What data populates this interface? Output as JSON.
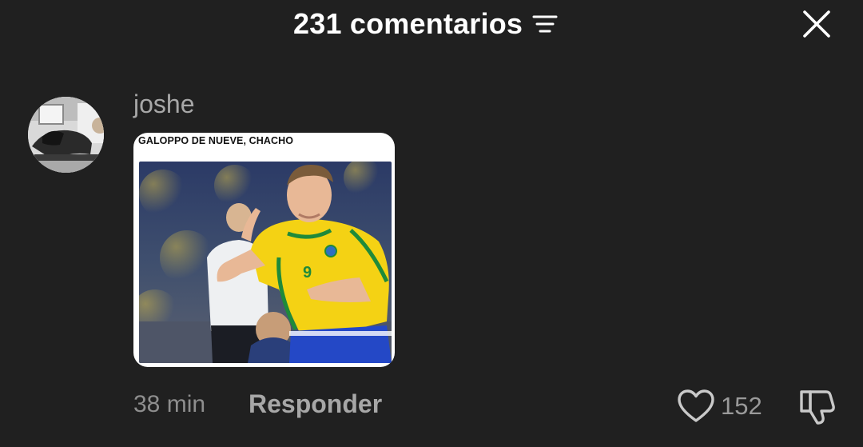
{
  "header": {
    "title": "231 comentarios",
    "sort_icon": "filter-sort-icon",
    "close_icon": "close-icon"
  },
  "comment": {
    "username": "joshe",
    "avatar_icon": "avatar-photo",
    "media": {
      "caption": "GALOPPO DE NUEVE, CHACHO",
      "photo": "soccer-player-celebrating-yellow-jersey"
    },
    "time": "38 min",
    "reply_label": "Responder",
    "likes": "152",
    "like_icon": "heart-icon",
    "dislike_icon": "thumbs-down-icon"
  },
  "colors": {
    "background": "#202020",
    "title": "#ffffff",
    "muted": "#a7a7a7",
    "time": "#8e8e8e"
  }
}
